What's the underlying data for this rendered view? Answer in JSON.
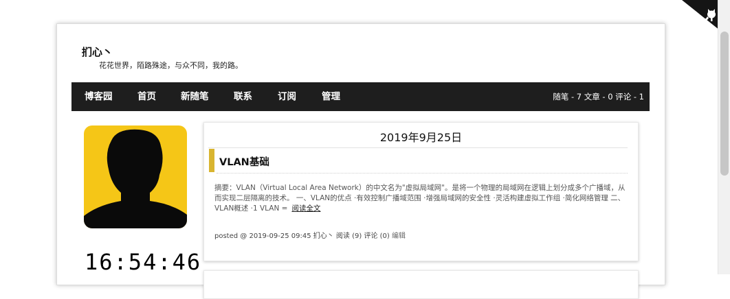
{
  "blog": {
    "title": "扪心丶",
    "subtitle": "花花世界，陌路殊途，与众不同，我的路。"
  },
  "nav": {
    "items": [
      "博客园",
      "首页",
      "新随笔",
      "联系",
      "订阅",
      "管理"
    ],
    "stats": "随笔 - 7  文章 - 0  评论 - 1"
  },
  "sidebar": {
    "clock": "16:54:46"
  },
  "post": {
    "date": "2019年9月25日",
    "title": "VLAN基础",
    "summary": "摘要：VLAN（Virtual Local Area Network）的中文名为\"虚拟局域网\"。是将一个物理的局域网在逻辑上划分成多个广播域，从而实现二层隔离的技术。 一、VLAN的优点 ·有效控制广播域范围 ·增强局域网的安全性 ·灵活构建虚拟工作组 ·简化网络管理 二、VLAN概述 ·1 VLAN =",
    "read_more": "阅读全文",
    "meta": "posted @ 2019-09-25 09:45 扪心丶 阅读 (9) 评论 (0)",
    "edit": "编辑"
  },
  "colors": {
    "navbar_bg": "#1e1e1e",
    "avatar_bg": "#f5c617",
    "title_accent": "#d9b530"
  }
}
